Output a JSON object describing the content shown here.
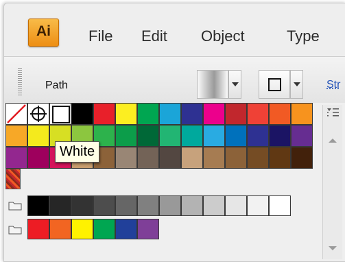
{
  "app": {
    "logo_text": "Ai"
  },
  "menu": {
    "items": [
      "File",
      "Edit",
      "Object",
      "Type"
    ]
  },
  "control_bar": {
    "selection_label": "Path",
    "stroke_link": "Str"
  },
  "swatches": {
    "tooltip": "White",
    "special_row": {
      "none_label": "None",
      "registration_label": "Registration",
      "white_label": "White",
      "colors": [
        "#000000",
        "#e8202a",
        "#fcee21",
        "#00a651",
        "#1ba5d8",
        "#2e3192",
        "#ec008c",
        "#c1272d",
        "#ef4136",
        "#f15a24",
        "#f7931e"
      ]
    },
    "row2": [
      "#f7a827",
      "#f4ea1d",
      "#d7df23",
      "#8cc63f",
      "#2db24c",
      "#0c9d4a",
      "#006837",
      "#22b573",
      "#00a99d",
      "#29abe2",
      "#0071bc",
      "#2e3192",
      "#1b1464",
      "#662d91"
    ],
    "row3": [
      "#93278f",
      "#9e005d",
      "#d4145a",
      "#c69c6d",
      "#8c6239",
      "#998675",
      "#736357",
      "#534741",
      "#c7a27c",
      "#a67c52",
      "#8c6239",
      "#754c24",
      "#603813",
      "#42210b"
    ],
    "grayscale": [
      "#000000",
      "#262626",
      "#333333",
      "#4d4d4d",
      "#666666",
      "#808080",
      "#999999",
      "#b3b3b3",
      "#cccccc",
      "#e6e6e6",
      "#f2f2f2",
      "#ffffff"
    ],
    "brights": [
      "#ed1c24",
      "#f26522",
      "#fff200",
      "#00a651",
      "#21409a",
      "#7f3f98"
    ]
  }
}
